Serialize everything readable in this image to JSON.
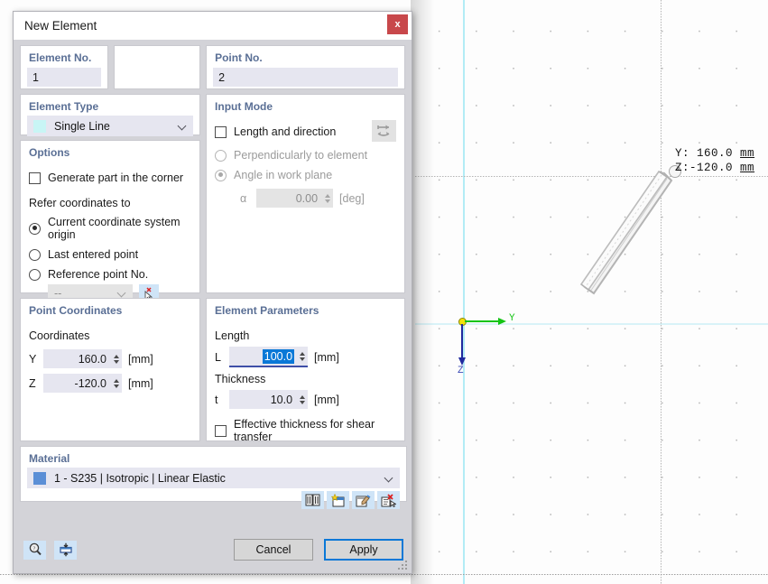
{
  "dialog": {
    "title": "New Element",
    "close_label": "x",
    "element_no": {
      "label": "Element No.",
      "value": "1"
    },
    "point_no": {
      "label": "Point No.",
      "value": "2"
    },
    "element_type": {
      "label": "Element Type",
      "selected": "Single Line",
      "swatch_color": "#c8f5f5"
    },
    "input_mode": {
      "label": "Input Mode",
      "length_and_direction": {
        "label": "Length and direction",
        "checked": false
      },
      "perpendicularly": {
        "label": "Perpendicularly to element",
        "selected": false,
        "enabled": false
      },
      "angle_in_work_plane": {
        "label": "Angle in work plane",
        "selected": true,
        "enabled": false
      },
      "alpha": {
        "label": "α",
        "value": "0.00",
        "unit": "[deg]",
        "enabled": false
      },
      "swap_icon": "swap-direction-icon"
    },
    "options": {
      "label": "Options",
      "generate_part": {
        "label": "Generate part in the corner",
        "checked": false
      },
      "refer_label": "Refer coordinates to",
      "refer_choices": [
        {
          "label": "Current coordinate system origin",
          "selected": true
        },
        {
          "label": "Last entered point",
          "selected": false
        },
        {
          "label": "Reference point No.",
          "selected": false
        }
      ],
      "reference_point_value": "--",
      "pick_icon": "pick-point-icon"
    },
    "point_coordinates": {
      "label": "Point Coordinates",
      "sub_label": "Coordinates",
      "rows": [
        {
          "name": "Y",
          "value": "160.0",
          "unit": "[mm]"
        },
        {
          "name": "Z",
          "value": "-120.0",
          "unit": "[mm]"
        }
      ]
    },
    "element_parameters": {
      "label": "Element Parameters",
      "length_label": "Length",
      "length": {
        "name": "L",
        "value": "100.0",
        "unit": "[mm]",
        "selected": true
      },
      "thickness_label": "Thickness",
      "thickness": {
        "name": "t",
        "value": "10.0",
        "unit": "[mm]"
      },
      "effective_thickness": {
        "label": "Effective thickness for shear transfer",
        "checked": false
      }
    },
    "material": {
      "label": "Material",
      "selected": "1 - S235 | Isotropic | Linear Elastic",
      "swatch_color": "#5b8fd6",
      "tools": [
        {
          "name": "material-library-icon"
        },
        {
          "name": "new-material-icon"
        },
        {
          "name": "edit-material-icon"
        },
        {
          "name": "delete-material-icon"
        }
      ]
    },
    "footer": {
      "help_icon": "help-magnifier-icon",
      "settings_icon": "display-settings-icon",
      "cancel_label": "Cancel",
      "apply_label": "Apply"
    }
  },
  "viewport": {
    "coord_readout": {
      "y_label": "Y:",
      "y_value": " 160.0",
      "y_unit": "mm",
      "z_label": "Z:",
      "z_value": "-120.0",
      "z_unit": "mm"
    },
    "axes": {
      "y_label": "Y",
      "z_label": "Z",
      "y_color": "#14c414",
      "z_color": "#202a9e",
      "origin_color": "#f2e30c"
    }
  }
}
